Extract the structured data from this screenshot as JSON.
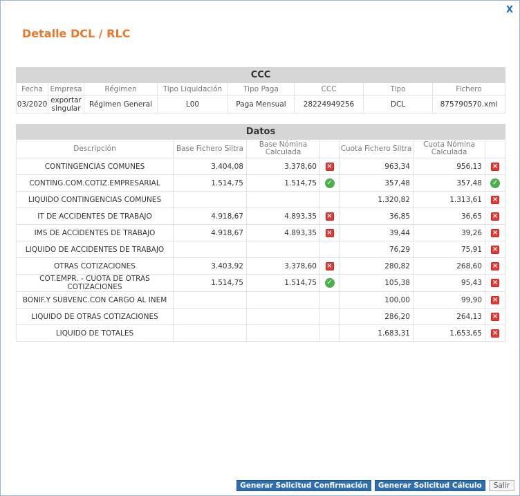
{
  "dialog": {
    "title": "Detalle DCL / RLC",
    "close_label": "X"
  },
  "ccc": {
    "section_title": "CCC",
    "headers": [
      "Fecha",
      "Empresa",
      "Régimen",
      "Tipo Liquidación",
      "Tipo Paga",
      "CCC",
      "Tipo",
      "Fichero"
    ],
    "row": {
      "fecha": "03/2020",
      "empresa": "exportar singular",
      "regimen": "Régimen General",
      "tipo_liquidacion": "L00",
      "tipo_paga": "Paga Mensual",
      "ccc": "28224949256",
      "tipo": "DCL",
      "fichero": "875790570.xml"
    }
  },
  "datos": {
    "section_title": "Datos",
    "headers": {
      "descripcion": "Descripción",
      "base_fichero": "Base Fichero Siltra",
      "base_nomina": "Base Nómina Calculada",
      "cuota_fichero": "Cuota Fichero Siltra",
      "cuota_nomina": "Cuota Nómina Calculada"
    },
    "rows": [
      {
        "desc": "CONTINGENCIAS COMUNES",
        "base_fichero": "3.404,08",
        "base_nomina": "3.378,60",
        "base_status": "error",
        "cuota_fichero": "963,34",
        "cuota_nomina": "956,13",
        "cuota_status": "error"
      },
      {
        "desc": "CONTING.COM.COTIZ.EMPRESARIAL",
        "base_fichero": "1.514,75",
        "base_nomina": "1.514,75",
        "base_status": "ok",
        "cuota_fichero": "357,48",
        "cuota_nomina": "357,48",
        "cuota_status": "ok"
      },
      {
        "desc": "LIQUIDO CONTINGENCIAS COMUNES",
        "base_fichero": "",
        "base_nomina": "",
        "base_status": "",
        "cuota_fichero": "1.320,82",
        "cuota_nomina": "1.313,61",
        "cuota_status": "error"
      },
      {
        "desc": "IT DE ACCIDENTES DE TRABAJO",
        "base_fichero": "4.918,67",
        "base_nomina": "4.893,35",
        "base_status": "error",
        "cuota_fichero": "36,85",
        "cuota_nomina": "36,65",
        "cuota_status": "error"
      },
      {
        "desc": "IMS DE ACCIDENTES DE TRABAJO",
        "base_fichero": "4.918,67",
        "base_nomina": "4.893,35",
        "base_status": "error",
        "cuota_fichero": "39,44",
        "cuota_nomina": "39,26",
        "cuota_status": "error"
      },
      {
        "desc": "LIQUIDO DE ACCIDENTES DE TRABAJO",
        "base_fichero": "",
        "base_nomina": "",
        "base_status": "",
        "cuota_fichero": "76,29",
        "cuota_nomina": "75,91",
        "cuota_status": "error"
      },
      {
        "desc": "OTRAS COTIZACIONES",
        "base_fichero": "3.403,92",
        "base_nomina": "3.378,60",
        "base_status": "error",
        "cuota_fichero": "280,82",
        "cuota_nomina": "268,60",
        "cuota_status": "error"
      },
      {
        "desc": "COT.EMPR. - CUOTA DE OTRAS COTIZACIONES",
        "base_fichero": "1.514,75",
        "base_nomina": "1.514,75",
        "base_status": "ok",
        "cuota_fichero": "105,38",
        "cuota_nomina": "95,43",
        "cuota_status": "error"
      },
      {
        "desc": "BONIF.Y SUBVENC.CON CARGO AL INEM",
        "base_fichero": "",
        "base_nomina": "",
        "base_status": "",
        "cuota_fichero": "100,00",
        "cuota_nomina": "99,90",
        "cuota_status": "error"
      },
      {
        "desc": "LIQUIDO DE OTRAS COTIZACIONES",
        "base_fichero": "",
        "base_nomina": "",
        "base_status": "",
        "cuota_fichero": "286,20",
        "cuota_nomina": "264,13",
        "cuota_status": "error"
      },
      {
        "desc": "LIQUIDO DE TOTALES",
        "base_fichero": "",
        "base_nomina": "",
        "base_status": "",
        "cuota_fichero": "1.683,31",
        "cuota_nomina": "1.653,65",
        "cuota_status": "error"
      }
    ]
  },
  "footer": {
    "confirm_label": "Generar Solicitud Confirmación",
    "calc_label": "Generar Solicitud Cálculo",
    "exit_label": "Salir"
  },
  "colors": {
    "title": "#e8782a",
    "primary_button": "#2e6eb0",
    "error_icon": "#e53935",
    "ok_icon": "#4cae4c",
    "section_header": "#d6d6d6"
  },
  "icons": {
    "error": "close-icon",
    "ok": "check-circle-icon"
  }
}
